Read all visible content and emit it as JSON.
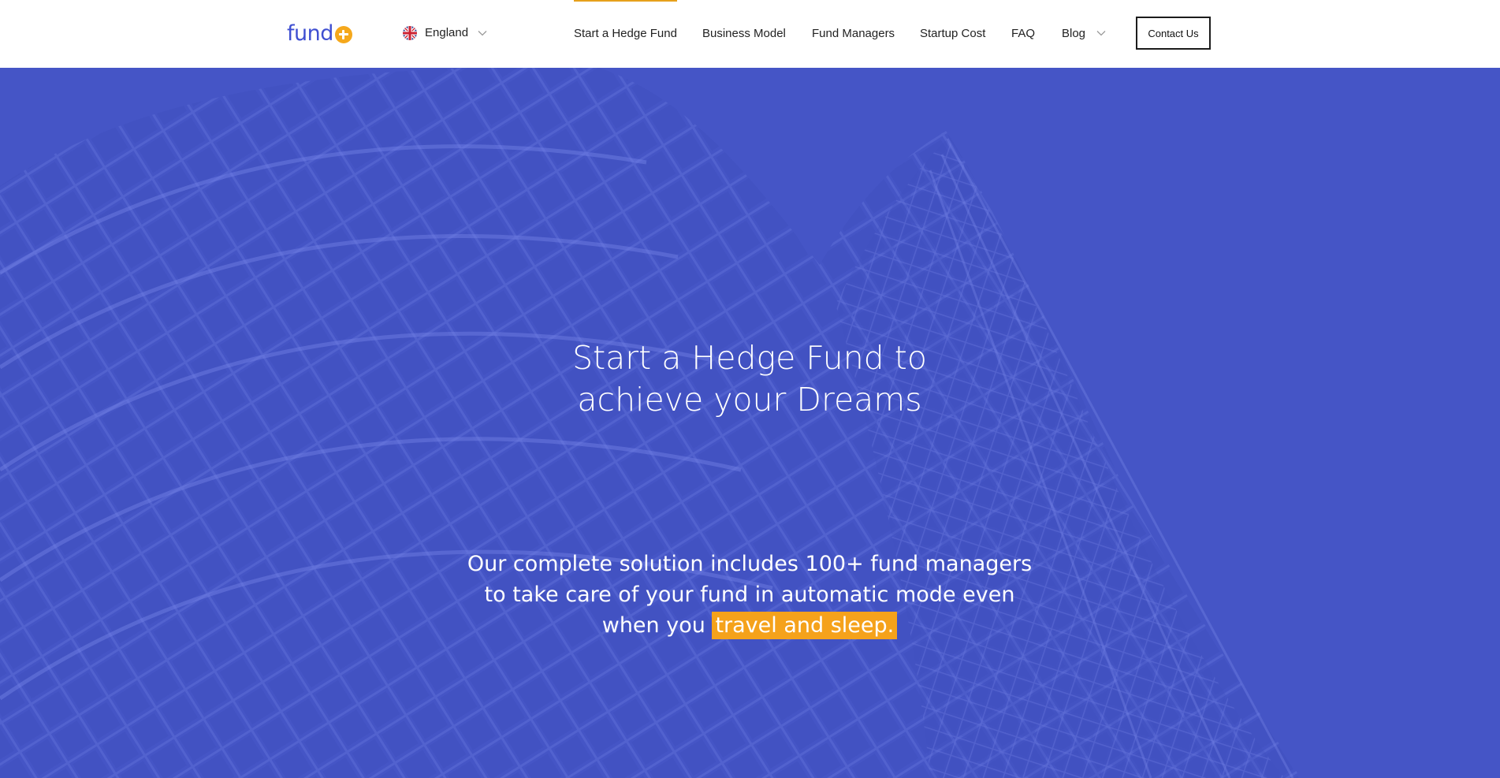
{
  "header": {
    "logo": {
      "text": "fund",
      "icon": "plus-circle-icon",
      "accent_color": "#f5a81c",
      "brand_color": "#3f4fd1"
    },
    "language": {
      "flag_icon": "uk-flag-icon",
      "label": "England",
      "dropdown_icon": "chevron-down-icon"
    },
    "nav": {
      "items": [
        {
          "label": "Start a Hedge Fund",
          "active": true
        },
        {
          "label": "Business Model"
        },
        {
          "label": "Fund Managers"
        },
        {
          "label": "Startup Cost"
        },
        {
          "label": "FAQ"
        },
        {
          "label": "Blog",
          "has_dropdown": true
        }
      ],
      "active_indicator_color": "#e6a01b"
    },
    "contact_button": {
      "label": "Contact Us"
    }
  },
  "hero": {
    "background_color": "#4555c6",
    "title_lines": [
      "Start a Hedge Fund to",
      "achieve your Dreams"
    ],
    "subtitle_lines": [
      "Our complete solution includes 100+ fund managers",
      "to take care of your fund in automatic mode even"
    ],
    "subtitle_last_prefix": "when you ",
    "subtitle_highlight": "travel and sleep.",
    "highlight_color": "#f5a21b"
  }
}
